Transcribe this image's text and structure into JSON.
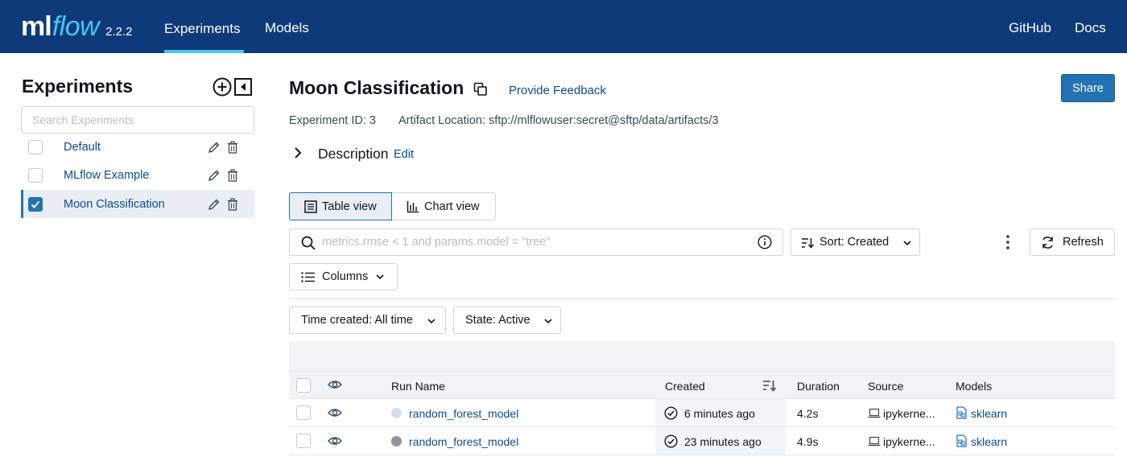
{
  "header": {
    "logo_ml": "ml",
    "logo_flow": "flow",
    "version": "2.2.2",
    "nav": {
      "experiments": "Experiments",
      "models": "Models",
      "github": "GitHub",
      "docs": "Docs"
    },
    "colors": {
      "background": "#0e3a7a",
      "accent": "#43c9ed"
    }
  },
  "sidebar": {
    "title": "Experiments",
    "search_placeholder": "Search Experiments",
    "experiments": [
      {
        "name": "Default",
        "checked": false,
        "selected": false
      },
      {
        "name": "MLflow Example",
        "checked": false,
        "selected": false
      },
      {
        "name": "Moon Classification",
        "checked": true,
        "selected": true
      }
    ]
  },
  "main": {
    "title": "Moon Classification",
    "feedback_link": "Provide Feedback",
    "share_label": "Share",
    "experiment_id_text": "Experiment ID: 3",
    "artifact_location_text": "Artifact Location: sftp://mlflowuser:secret@sftp/data/artifacts/3",
    "description_label": "Description",
    "description_edit": "Edit",
    "views": {
      "table": "Table view",
      "chart": "Chart view",
      "active": "table"
    },
    "search_placeholder": "metrics.rmse < 1 and params.model = \"tree\"",
    "sort_label": "Sort: Created",
    "refresh_label": "Refresh",
    "columns_label": "Columns",
    "filters": {
      "time_created": "Time created: All time",
      "state": "State: Active"
    }
  },
  "table": {
    "columns": {
      "run_name": "Run Name",
      "created": "Created",
      "duration": "Duration",
      "source": "Source",
      "models": "Models"
    },
    "rows": [
      {
        "run_name": "random_forest_model",
        "created": "6 minutes ago",
        "duration": "4.2s",
        "source": "ipykerne...",
        "model": "sklearn",
        "dot_color": "#d6dde5"
      },
      {
        "run_name": "random_forest_model",
        "created": "23 minutes ago",
        "duration": "4.9s",
        "source": "ipykerne...",
        "model": "sklearn",
        "dot_color": "#8e959c"
      }
    ]
  }
}
